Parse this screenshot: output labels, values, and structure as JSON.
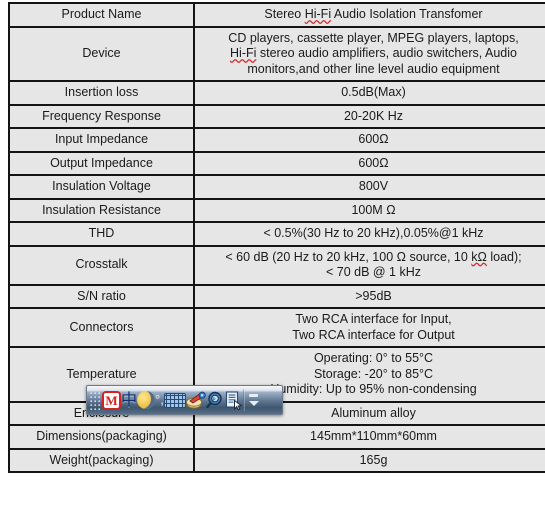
{
  "table": {
    "rows": [
      {
        "label": "Product Name",
        "lines": [
          "Stereo Hi-Fi Audio Isolation Transfomer"
        ],
        "misspelled": [
          "Hi-Fi"
        ]
      },
      {
        "label": "Device",
        "lines": [
          "CD players, cassette player, MPEG players, laptops,",
          "Hi-Fi stereo audio amplifiers, audio switchers, Audio",
          "monitors,and other line level audio equipment"
        ],
        "misspelled": [
          "Hi-Fi"
        ]
      },
      {
        "label": "Insertion loss",
        "lines": [
          "0.5dB(Max)"
        ]
      },
      {
        "label": "Frequency Response",
        "lines": [
          "20-20K Hz"
        ]
      },
      {
        "label": "Input Impedance",
        "lines": [
          "600Ω"
        ]
      },
      {
        "label": "Output Impedance",
        "lines": [
          "600Ω"
        ]
      },
      {
        "label": "Insulation Voltage",
        "lines": [
          "800V"
        ]
      },
      {
        "label": "Insulation Resistance",
        "lines": [
          "100M Ω"
        ]
      },
      {
        "label": "THD",
        "lines": [
          "< 0.5%(30 Hz to 20 kHz),0.05%@1 kHz"
        ]
      },
      {
        "label": "Crosstalk",
        "lines": [
          "< 60 dB (20 Hz to 20 kHz, 100 Ω source, 10 kΩ load);",
          "< 70 dB @ 1 kHz"
        ],
        "misspelled": [
          "kΩ"
        ]
      },
      {
        "label": "S/N ratio",
        "lines": [
          ">95dB"
        ]
      },
      {
        "label": "Connectors",
        "lines": [
          "Two RCA interface for Input,",
          "Two RCA interface for Output"
        ]
      },
      {
        "label": "Temperature",
        "lines": [
          "Operating: 0° to 55°C",
          "Storage: -20° to 85°C",
          "Humidity: Up to 95% non-condensing"
        ]
      },
      {
        "label": "Enclosure",
        "lines": [
          "Aluminum alloy"
        ]
      },
      {
        "label": "Dimensions(packaging)",
        "lines": [
          "145mm*110mm*60mm"
        ]
      },
      {
        "label": "Weight(packaging)",
        "lines": [
          "165g"
        ]
      }
    ]
  },
  "ime_toolbar": {
    "buttons": [
      {
        "name": "drag-grip",
        "label": ""
      },
      {
        "name": "ime-logo-m",
        "label": "M"
      },
      {
        "name": "chinese-english-toggle",
        "label": "中"
      },
      {
        "name": "moon-mode",
        "label": ""
      },
      {
        "name": "punctuation-toggle",
        "label": "°,"
      },
      {
        "name": "soft-keyboard",
        "label": ""
      },
      {
        "name": "input-palette",
        "label": ""
      },
      {
        "name": "handwriting-search",
        "label": ""
      },
      {
        "name": "toolbox-menu",
        "label": ""
      },
      {
        "name": "minimize-expand",
        "label": ""
      }
    ]
  },
  "colors": {
    "cell_background": "#e6e6e6",
    "border": "#141414",
    "text": "#1a1a1a",
    "spell_underline": "#d12b2b",
    "ime_accent": "#d62121"
  }
}
